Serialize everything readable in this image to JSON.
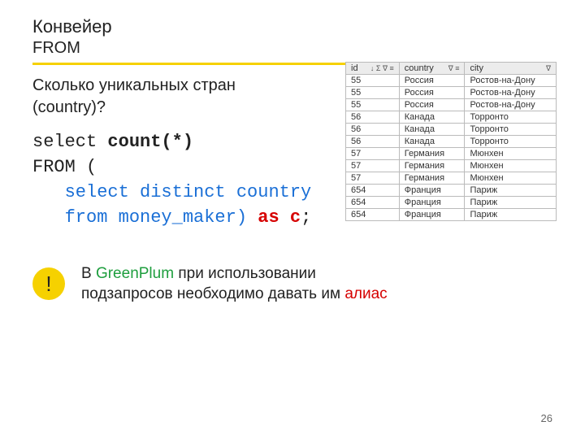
{
  "title_line1": "Конвейер",
  "title_line2": "FROM",
  "question_line1": "Сколько уникальных стран",
  "question_line2": "(country)?",
  "sql": {
    "l1a": "select ",
    "l1b": "count(*)",
    "l2": "FROM (",
    "l3": "   select distinct country",
    "l4a": "   from money_maker) ",
    "l4b": "as c",
    "l4c": ";"
  },
  "note": {
    "bang": "!",
    "p1": "В ",
    "green": "GreenPlum",
    "p2": " при использовании подзапросов необходимо давать им ",
    "red": "алиас"
  },
  "table": {
    "headers": {
      "id": "id",
      "id_sym": "↓ Σ ∇ ≡",
      "country": "country",
      "country_sym": "∇ ≡",
      "city": "city",
      "city_sym": "∇"
    },
    "rows": [
      {
        "id": "55",
        "country": "Россия",
        "city": "Ростов-на-Дону"
      },
      {
        "id": "55",
        "country": "Россия",
        "city": "Ростов-на-Дону"
      },
      {
        "id": "55",
        "country": "Россия",
        "city": "Ростов-на-Дону"
      },
      {
        "id": "56",
        "country": "Канада",
        "city": "Торронто"
      },
      {
        "id": "56",
        "country": "Канада",
        "city": "Торронто"
      },
      {
        "id": "56",
        "country": "Канада",
        "city": "Торронто"
      },
      {
        "id": "57",
        "country": "Германия",
        "city": "Мюнхен"
      },
      {
        "id": "57",
        "country": "Германия",
        "city": "Мюнхен"
      },
      {
        "id": "57",
        "country": "Германия",
        "city": "Мюнхен"
      },
      {
        "id": "654",
        "country": "Франция",
        "city": "Париж"
      },
      {
        "id": "654",
        "country": "Франция",
        "city": "Париж"
      },
      {
        "id": "654",
        "country": "Франция",
        "city": "Париж"
      }
    ]
  },
  "page_number": "26"
}
